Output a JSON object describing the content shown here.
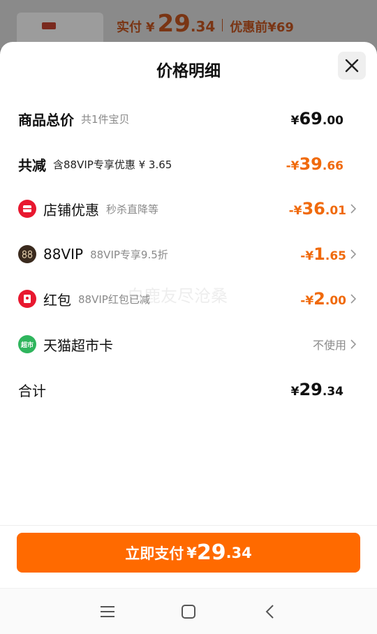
{
  "background": {
    "paid_label": "实付",
    "paid_currency": "¥",
    "paid_int": "29",
    "paid_dec": ".34",
    "original_label": "优惠前",
    "original_price": "¥69"
  },
  "sheet": {
    "title": "价格明细",
    "rows": [
      {
        "label": "商品总价",
        "sub": "共1件宝贝",
        "currency": "¥",
        "int": "69",
        "dec": ".00"
      },
      {
        "label": "共减",
        "sub": "含88VIP专享优惠 ¥ 3.65",
        "currency": "-¥",
        "int": "39",
        "dec": ".66"
      },
      {
        "label": "店铺优惠",
        "sub": "秒杀直降等",
        "currency": "-¥",
        "int": "36",
        "dec": ".01",
        "icon": "store-coupon-icon"
      },
      {
        "label": "88VIP",
        "sub": "88VIP专享9.5折",
        "currency": "-¥",
        "int": "1",
        "dec": ".65",
        "icon": "88vip-icon"
      },
      {
        "label": "红包",
        "sub": "88VIP红包已减",
        "currency": "-¥",
        "int": "2",
        "dec": ".00",
        "icon": "red-packet-icon"
      },
      {
        "label": "天猫超市卡",
        "value": "不使用",
        "icon": "tmall-supermarket-card-icon",
        "icon_text": "超市"
      },
      {
        "label": "合计",
        "currency": "¥",
        "int": "29",
        "dec": ".34"
      }
    ],
    "watermark": "白鹿友尽沧桑"
  },
  "pay_button": {
    "label": "立即支付",
    "currency": "¥",
    "int": "29",
    "dec": ".34"
  },
  "colors": {
    "accent": "#ff6a00",
    "discount_text": "#f06a0c",
    "store_icon": "#e8182f",
    "vip_icon": "#3a2a1e",
    "supermarket_icon": "#2fb55d"
  },
  "navbar": {
    "icons": [
      "menu-icon",
      "home-icon",
      "back-icon"
    ]
  }
}
